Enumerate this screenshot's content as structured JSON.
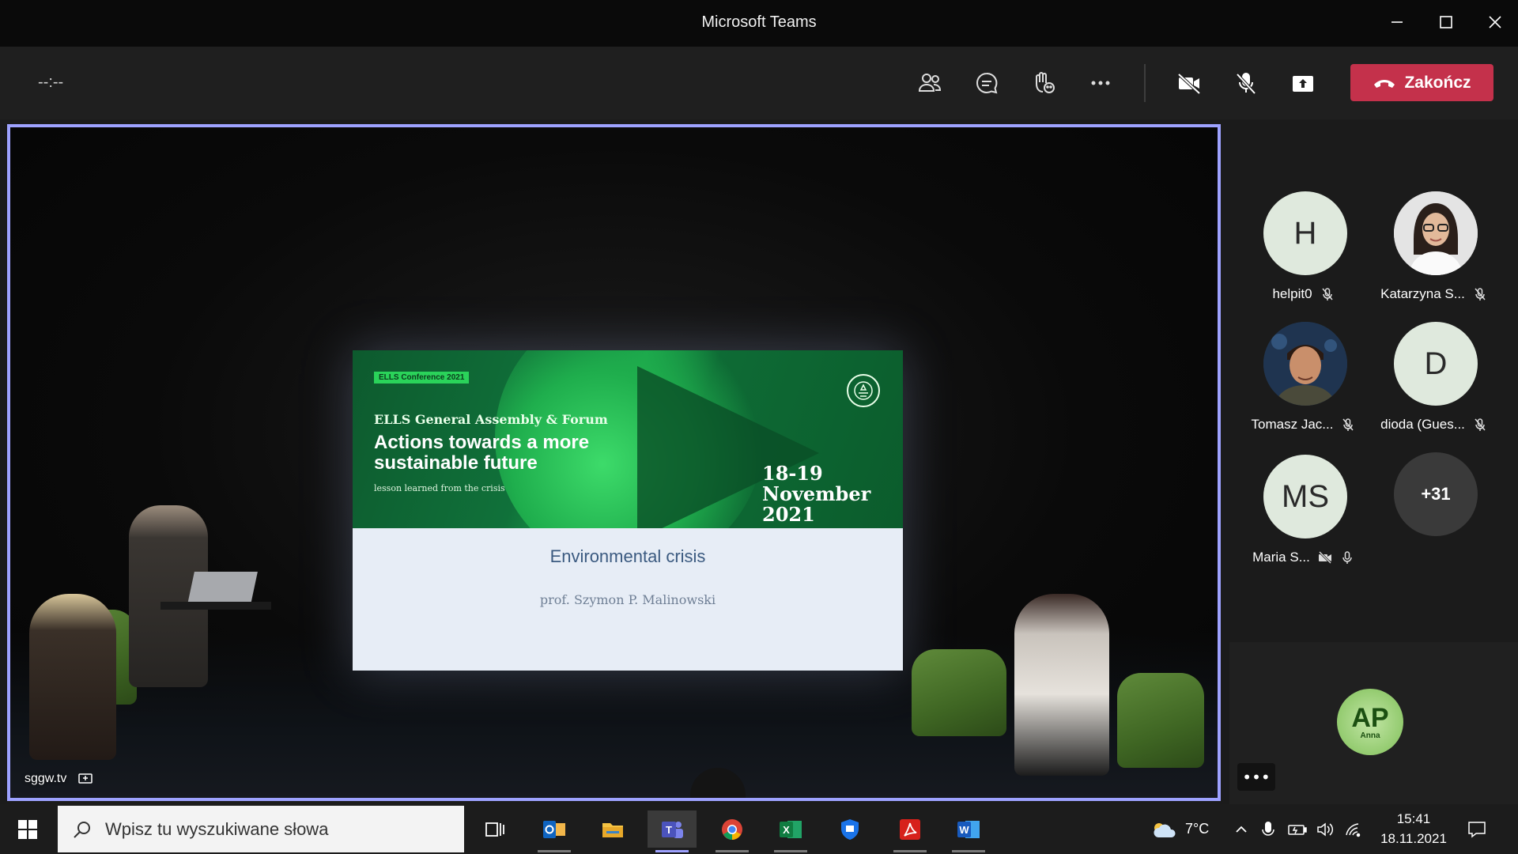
{
  "window": {
    "title": "Microsoft Teams"
  },
  "toolbar": {
    "timer": "--:--",
    "end_label": "Zakończ"
  },
  "stage": {
    "source_label": "sggw.tv",
    "slide": {
      "tag": "ELLS Conference 2021",
      "subtitle": "ELLS General Assembly & Forum",
      "headline": "Actions towards a more sustainable future",
      "lesson": "lesson learned from the crisis",
      "date": "18-19 November 2021",
      "talk_title": "Environmental crisis",
      "author": "prof. Szymon P. Malinowski"
    }
  },
  "participants": [
    {
      "name": "helpit0",
      "initials": "H",
      "avatar": "initials",
      "status": "mic-off"
    },
    {
      "name": "Katarzyna S...",
      "initials": "",
      "avatar": "photo-woman",
      "status": "mic-off"
    },
    {
      "name": "Tomasz Jac...",
      "initials": "",
      "avatar": "photo-man",
      "status": "mic-off"
    },
    {
      "name": "dioda (Gues...",
      "initials": "D",
      "avatar": "initials",
      "status": "mic-off"
    },
    {
      "name": "Maria S...",
      "initials": "MS",
      "avatar": "initials",
      "status": "mic-on"
    }
  ],
  "overflow_count": "+31",
  "self": {
    "initials": "AP",
    "name": "Anna",
    "more_label": "•••"
  },
  "taskbar": {
    "search_placeholder": "Wpisz tu wyszukiwane słowa",
    "weather": "7°C",
    "time": "15:41",
    "date": "18.11.2021",
    "apps": [
      "task-view",
      "outlook",
      "file-explorer",
      "teams",
      "chrome",
      "excel",
      "defender",
      "acrobat",
      "word"
    ]
  },
  "colors": {
    "end_call": "#c4314b",
    "active_border": "#9ea2ff",
    "toolbar_bg": "#1f1f1f"
  }
}
